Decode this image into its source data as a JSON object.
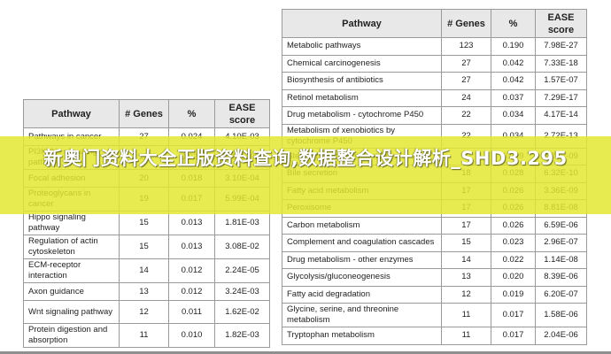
{
  "headers": {
    "pathway": "Pathway",
    "genes": "# Genes",
    "percent": "%",
    "ease_line1": "EASE",
    "ease_line2": "score"
  },
  "left_table": [
    {
      "pathway": "Pathways in cancer",
      "genes": "27",
      "percent": "0.024",
      "ease": "4.10E-03"
    },
    {
      "pathway": "PI3K-Akt signaling pathway",
      "genes": "25",
      "percent": "0.022",
      "ease": "1.93E-03"
    },
    {
      "pathway": "Focal adhesion",
      "genes": "20",
      "percent": "0.018",
      "ease": "3.10E-04"
    },
    {
      "pathway": "Proteoglycans in cancer",
      "genes": "19",
      "percent": "0.017",
      "ease": "5.99E-04"
    },
    {
      "pathway": "Hippo signaling pathway",
      "genes": "15",
      "percent": "0.013",
      "ease": "1.81E-03"
    },
    {
      "pathway": "Regulation of actin cytoskeleton",
      "genes": "15",
      "percent": "0.013",
      "ease": "3.08E-02"
    },
    {
      "pathway": "ECM-receptor interaction",
      "genes": "14",
      "percent": "0.012",
      "ease": "2.24E-05"
    },
    {
      "pathway": "Axon guidance",
      "genes": "13",
      "percent": "0.012",
      "ease": "3.24E-03"
    },
    {
      "pathway": "Wnt signaling pathway",
      "genes": "12",
      "percent": "0.011",
      "ease": "1.62E-02"
    },
    {
      "pathway": "Protein digestion and absorption",
      "genes": "11",
      "percent": "0.010",
      "ease": "1.82E-03"
    }
  ],
  "right_table": [
    {
      "pathway": "Metabolic pathways",
      "genes": "123",
      "percent": "0.190",
      "ease": "7.98E-27"
    },
    {
      "pathway": "Chemical carcinogenesis",
      "genes": "27",
      "percent": "0.042",
      "ease": "7.33E-18"
    },
    {
      "pathway": "Biosynthesis of antibiotics",
      "genes": "27",
      "percent": "0.042",
      "ease": "1.57E-07"
    },
    {
      "pathway": "Retinol metabolism",
      "genes": "24",
      "percent": "0.037",
      "ease": "7.29E-17"
    },
    {
      "pathway": "Drug metabolism - cytochrome P450",
      "genes": "22",
      "percent": "0.034",
      "ease": "4.17E-14"
    },
    {
      "pathway": "Metabolism of xenobiotics by cytochrome P450",
      "genes": "22",
      "percent": "0.034",
      "ease": "2.72E-13"
    },
    {
      "pathway": "Steroid hormone biosynthesis",
      "genes": "19",
      "percent": "0.029",
      "ease": "1.73E-09"
    },
    {
      "pathway": "Bile secretion",
      "genes": "18",
      "percent": "0.028",
      "ease": "6.32E-10"
    },
    {
      "pathway": "Fatty acid metabolism",
      "genes": "17",
      "percent": "0.026",
      "ease": "3.36E-09"
    },
    {
      "pathway": "Peroxisome",
      "genes": "17",
      "percent": "0.026",
      "ease": "8.81E-08"
    },
    {
      "pathway": "Carbon metabolism",
      "genes": "17",
      "percent": "0.026",
      "ease": "6.59E-06"
    },
    {
      "pathway": "Complement and coagulation cascades",
      "genes": "15",
      "percent": "0.023",
      "ease": "2.96E-07"
    },
    {
      "pathway": "Drug metabolism - other enzymes",
      "genes": "14",
      "percent": "0.022",
      "ease": "1.14E-08"
    },
    {
      "pathway": "Glycolysis/gluconeogenesis",
      "genes": "13",
      "percent": "0.020",
      "ease": "8.39E-06"
    },
    {
      "pathway": "Fatty acid degradation",
      "genes": "12",
      "percent": "0.019",
      "ease": "6.20E-07"
    },
    {
      "pathway": "Glycine, serine, and threonine metabolism",
      "genes": "11",
      "percent": "0.017",
      "ease": "1.58E-06"
    },
    {
      "pathway": "Tryptophan metabolism",
      "genes": "11",
      "percent": "0.017",
      "ease": "2.04E-06"
    }
  ],
  "banner": {
    "text": "新奥门资料大全正版资料查询,数据整合设计解析_SHD3.295",
    "color": "#e2e72d"
  }
}
